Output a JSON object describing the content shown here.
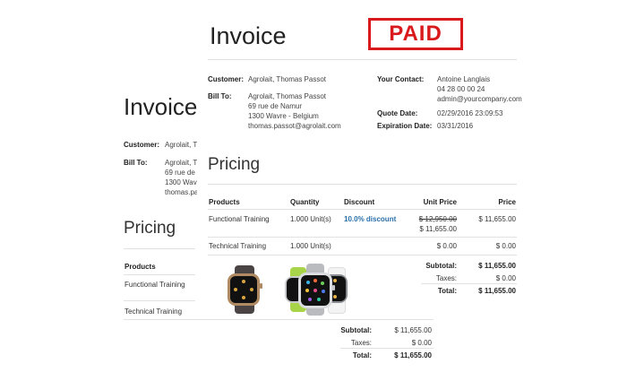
{
  "back": {
    "title": "Invoice",
    "customer_label": "Customer:",
    "customer_value": "Agrolait, T",
    "billto_label": "Bill To:",
    "billto_lines": [
      "Agrolait, T",
      "69 rue de",
      "1300 Wav",
      "thomas.pa"
    ],
    "pricing_title": "Pricing",
    "products_header": "Products",
    "rows": [
      "Functional Training",
      "Technical Training"
    ],
    "totals": {
      "subtotal_label": "Subtotal:",
      "subtotal_value": "$ 11,655.00",
      "taxes_label": "Taxes:",
      "taxes_value": "$ 0.00",
      "total_label": "Total:",
      "total_value": "$ 11,655.00"
    }
  },
  "front": {
    "title": "Invoice",
    "stamp": "PAID",
    "customer_label": "Customer:",
    "customer_value": "Agrolait, Thomas Passot",
    "billto_label": "Bill To:",
    "billto_lines": [
      "Agrolait, Thomas Passot",
      "69 rue de Namur",
      "1300 Wavre - Belgium",
      "thomas.passot@agrolait.com"
    ],
    "contact_label": "Your Contact:",
    "contact_lines": [
      "Antoine Langlais",
      "04 28 00 00 24",
      "admin@yourcompany.com"
    ],
    "quote_date_label": "Quote Date:",
    "quote_date_value": "02/29/2016 23:09:53",
    "expiration_label": "Expiration Date:",
    "expiration_value": "03/31/2016",
    "pricing_title": "Pricing",
    "headers": {
      "products": "Products",
      "quantity": "Quantity",
      "discount": "Discount",
      "unit_price": "Unit Price",
      "price": "Price"
    },
    "rows": [
      {
        "product": "Functional Training",
        "quantity": "1.000 Unit(s)",
        "discount": "10.0% discount",
        "old_unit_price": "$ 12,950.00",
        "unit_price": "$ 11,655.00",
        "price": "$ 11,655.00"
      },
      {
        "product": "Technical Training",
        "quantity": "1.000 Unit(s)",
        "discount": "",
        "unit_price": "$ 0.00",
        "price": "$ 0.00"
      }
    ],
    "totals": {
      "subtotal_label": "Subtotal:",
      "subtotal_value": "$ 11,655.00",
      "taxes_label": "Taxes:",
      "taxes_value": "$ 0.00",
      "total_label": "Total:",
      "total_value": "$ 11,655.00"
    }
  },
  "colors": {
    "stamp": "#d9191b",
    "discount": "#2a6fa8"
  }
}
